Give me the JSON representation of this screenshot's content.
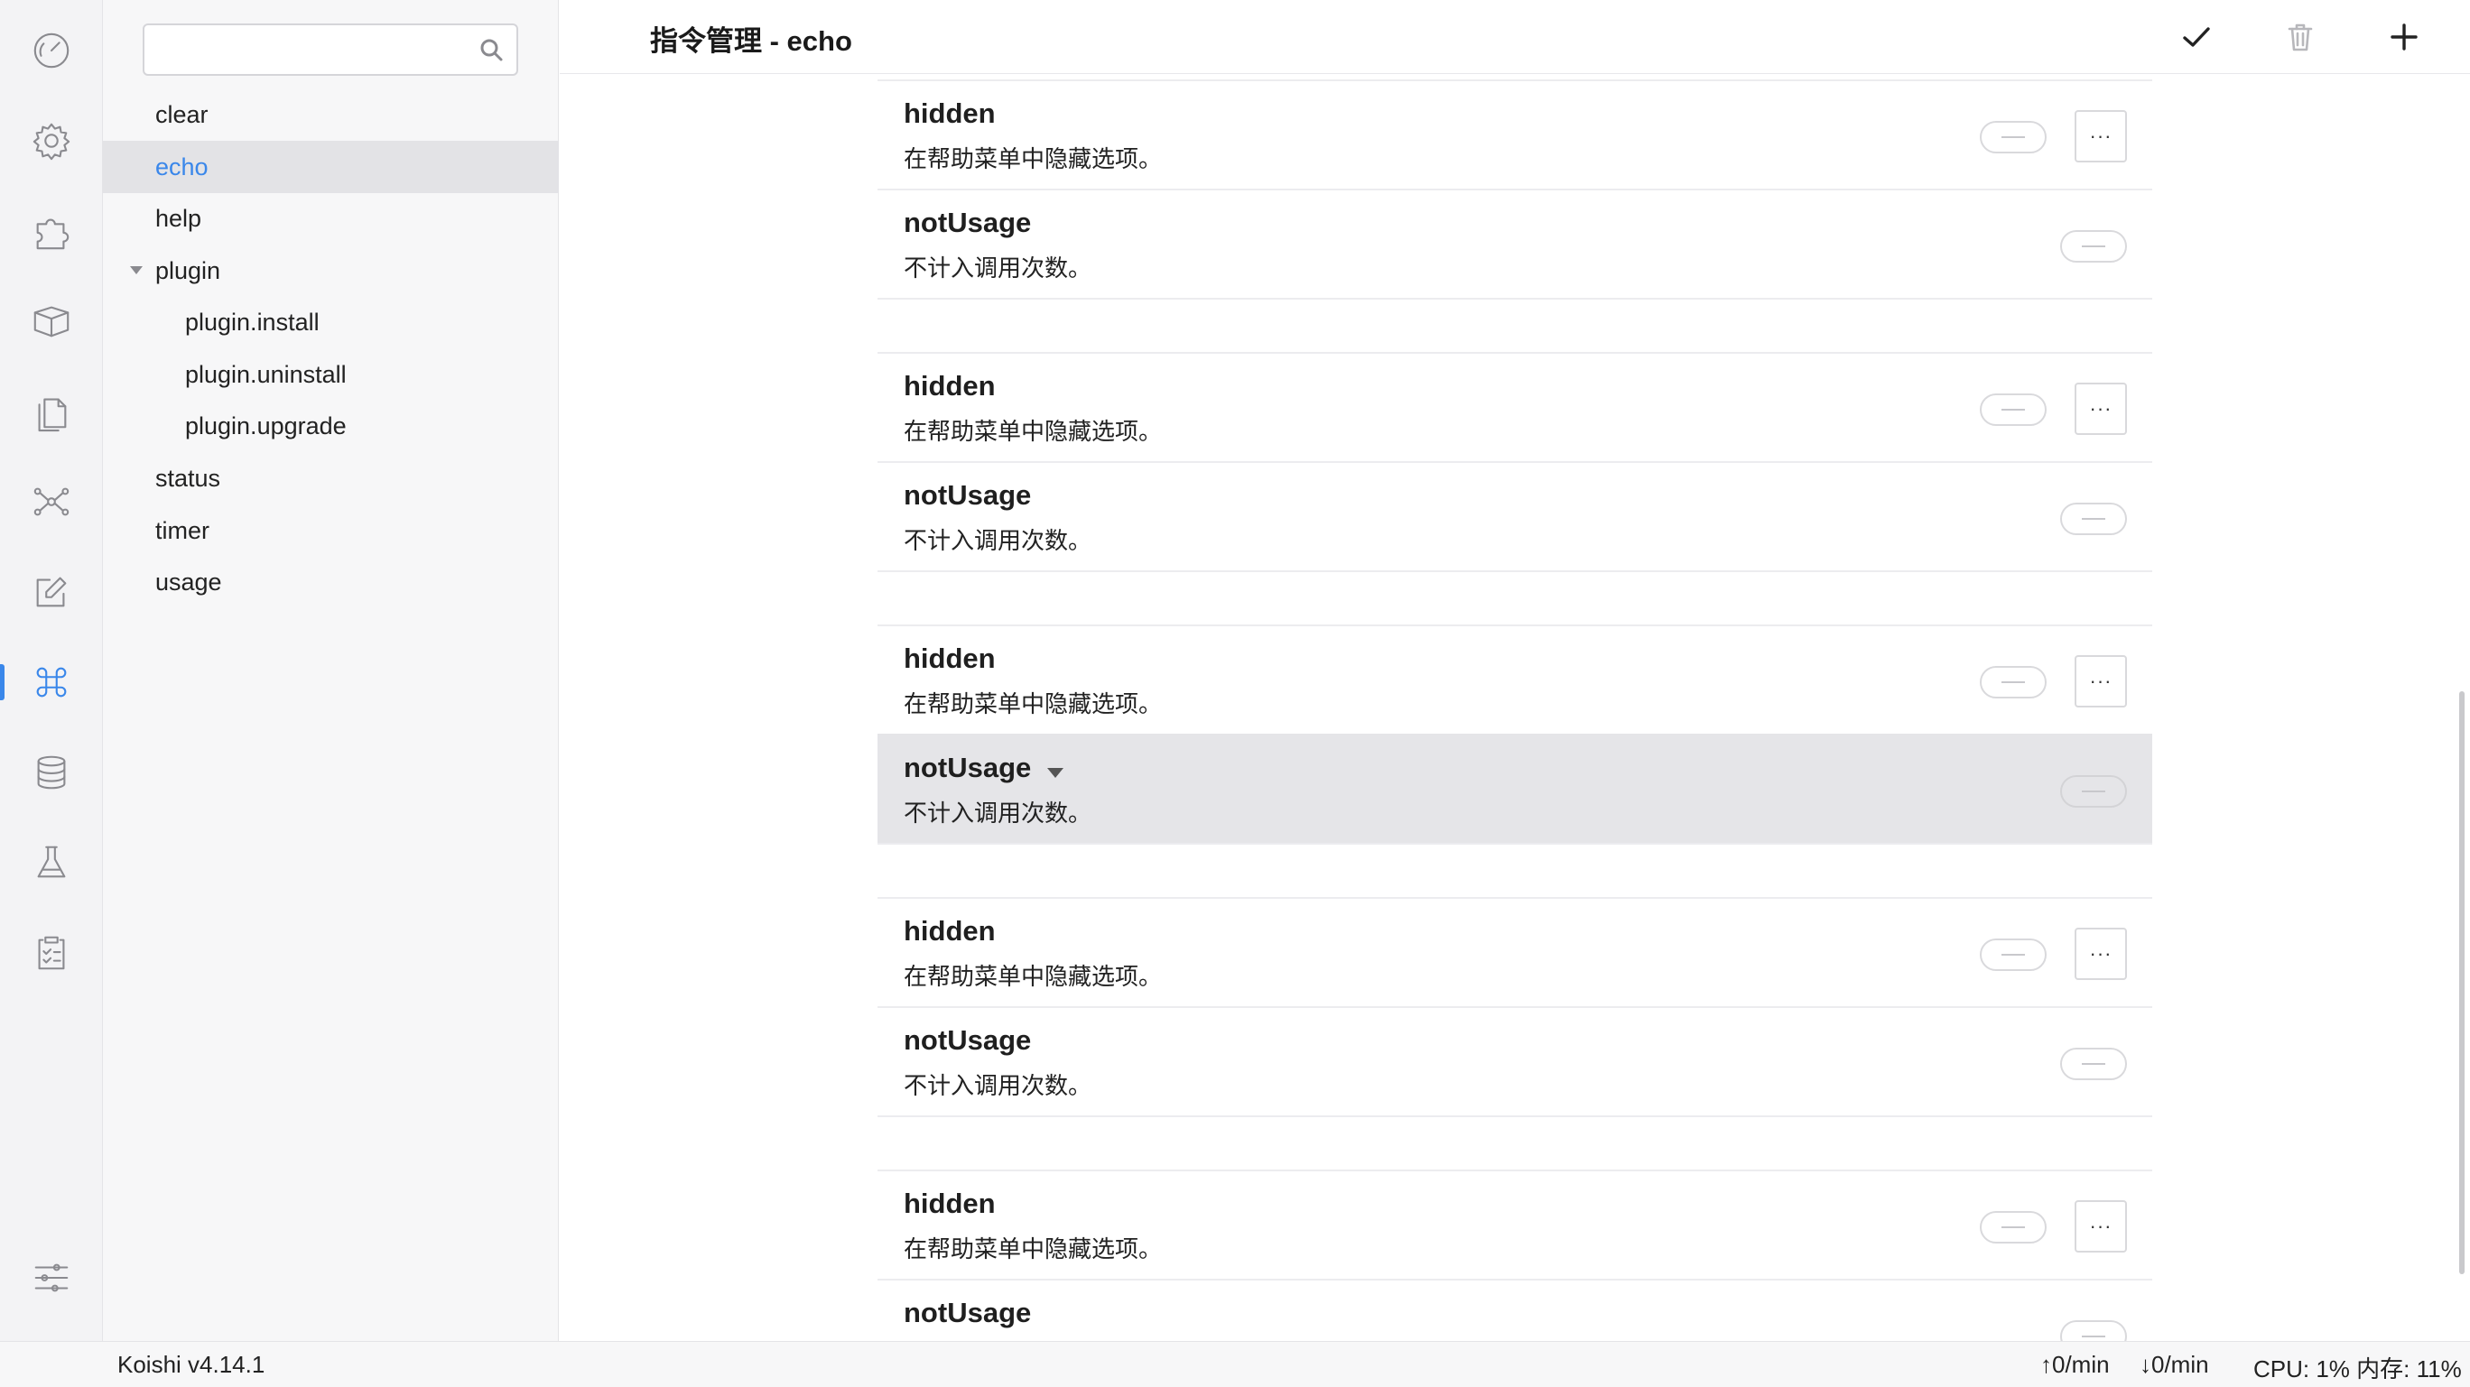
{
  "activity_bar": [
    {
      "icon": "dashboard-icon",
      "active": false
    },
    {
      "icon": "gear-icon",
      "active": false
    },
    {
      "icon": "puzzle-icon",
      "active": false
    },
    {
      "icon": "package-icon",
      "active": false
    },
    {
      "icon": "files-icon",
      "active": false
    },
    {
      "icon": "network-icon",
      "active": false
    },
    {
      "icon": "edit-icon",
      "active": false
    },
    {
      "icon": "command-icon",
      "active": true
    },
    {
      "icon": "database-icon",
      "active": false
    },
    {
      "icon": "flask-icon",
      "active": false
    },
    {
      "icon": "clipboard-icon",
      "active": false
    },
    {
      "icon": "sliders-icon",
      "active": false
    }
  ],
  "sidebar": {
    "search_placeholder": "",
    "items": [
      {
        "label": "clear"
      },
      {
        "label": "echo"
      },
      {
        "label": "help"
      },
      {
        "label": "plugin"
      },
      {
        "label": "plugin.install"
      },
      {
        "label": "plugin.uninstall"
      },
      {
        "label": "plugin.upgrade"
      },
      {
        "label": "status"
      },
      {
        "label": "timer"
      },
      {
        "label": "usage"
      }
    ]
  },
  "header": {
    "title": "指令管理 - echo",
    "actions": [
      "check-icon",
      "trash-icon",
      "plus-icon"
    ]
  },
  "content": {
    "more_label": "···",
    "rows": [
      {
        "name": "hidden",
        "desc": "在帮助菜单中隐藏选项。"
      },
      {
        "name": "notUsage",
        "desc": "不计入调用次数。"
      },
      {
        "name": "hidden",
        "desc": "在帮助菜单中隐藏选项。"
      },
      {
        "name": "notUsage",
        "desc": "不计入调用次数。"
      },
      {
        "name": "hidden",
        "desc": "在帮助菜单中隐藏选项。"
      },
      {
        "name": "notUsage",
        "desc": "不计入调用次数。"
      },
      {
        "name": "hidden",
        "desc": "在帮助菜单中隐藏选项。"
      },
      {
        "name": "notUsage",
        "desc": "不计入调用次数。"
      },
      {
        "name": "hidden",
        "desc": "在帮助菜单中隐藏选项。"
      },
      {
        "name": "notUsage",
        "desc": ""
      }
    ]
  },
  "status_bar": {
    "version": "Koishi v4.14.1",
    "upload": "0/min",
    "download": "0/min",
    "cpu_mem": "CPU: 1% 内存: 11%"
  }
}
